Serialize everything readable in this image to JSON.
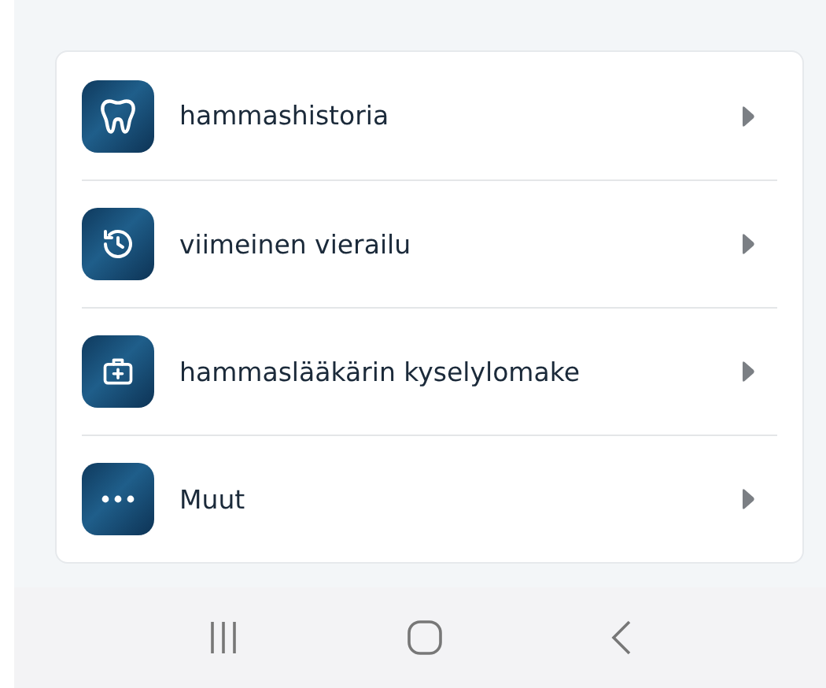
{
  "menu": [
    {
      "label": "hammashistoria"
    },
    {
      "label": "viimeinen vierailu"
    },
    {
      "label": "hammaslääkärin kyselylomake"
    },
    {
      "label": "Muut"
    }
  ]
}
